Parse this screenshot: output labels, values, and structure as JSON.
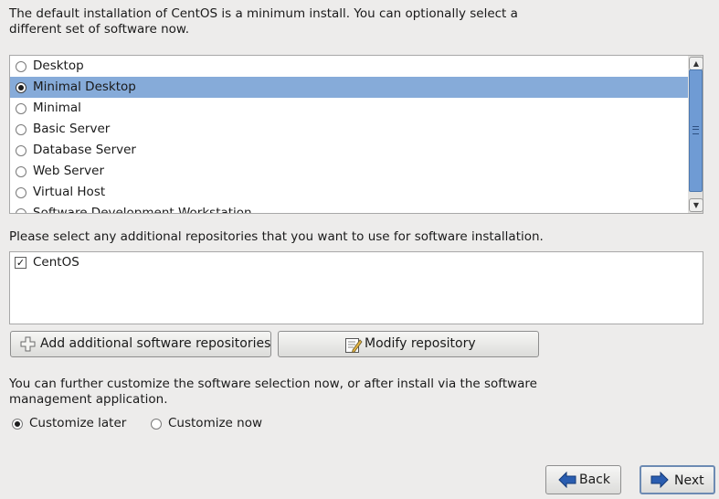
{
  "intro_text": "The default installation of CentOS is a minimum install. You can optionally select a different set of software now.",
  "software_sets": [
    {
      "label": "Desktop",
      "selected": false
    },
    {
      "label": "Minimal Desktop",
      "selected": true
    },
    {
      "label": "Minimal",
      "selected": false
    },
    {
      "label": "Basic Server",
      "selected": false
    },
    {
      "label": "Database Server",
      "selected": false
    },
    {
      "label": "Web Server",
      "selected": false
    },
    {
      "label": "Virtual Host",
      "selected": false
    },
    {
      "label": "Software Development Workstation",
      "selected": false
    }
  ],
  "repo_prompt": "Please select any additional repositories that you want to use for software installation.",
  "repositories": [
    {
      "label": "CentOS",
      "checked": true
    }
  ],
  "buttons": {
    "add_repo": "Add additional software repositories",
    "modify_repo": "Modify repository",
    "back": "Back",
    "next": "Next"
  },
  "customize_text": "You can further customize the software selection now, or after install via the software management application.",
  "customize_options": [
    {
      "label": "Customize later",
      "selected": true
    },
    {
      "label": "Customize now",
      "selected": false
    }
  ],
  "colors": {
    "selection_highlight": "#86abd9",
    "scroll_thumb": "#6f9bd4",
    "nav_arrow": "#2a5db0"
  },
  "icons": [
    "plus-icon",
    "edit-document-icon",
    "back-arrow-icon",
    "next-arrow-icon",
    "scroll-up-icon",
    "scroll-down-icon"
  ]
}
